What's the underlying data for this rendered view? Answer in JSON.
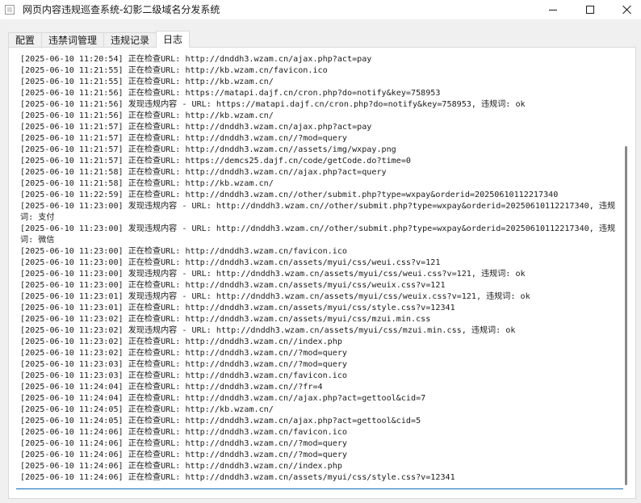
{
  "window": {
    "title": "网页内容违规巡查系统-幻影二级域名分发系统"
  },
  "tabs": [
    {
      "label": "配置"
    },
    {
      "label": "违禁词管理"
    },
    {
      "label": "违规记录"
    },
    {
      "label": "日志"
    }
  ],
  "active_tab": "日志",
  "log": {
    "lines": [
      "[2025-06-10 11:20:54] 正在检查URL: http://dnddh3.wzam.cn/ajax.php?act=pay",
      "[2025-06-10 11:21:55] 正在检查URL: http://kb.wzam.cn/favicon.ico",
      "[2025-06-10 11:21:55] 正在检查URL: http://kb.wzam.cn/",
      "[2025-06-10 11:21:56] 正在检查URL: https://matapi.dajf.cn/cron.php?do=notify&key=758953",
      "[2025-06-10 11:21:56] 发现违规内容 - URL: https://matapi.dajf.cn/cron.php?do=notify&key=758953, 违规词: ok",
      "[2025-06-10 11:21:56] 正在检查URL: http://kb.wzam.cn/",
      "[2025-06-10 11:21:57] 正在检查URL: http://dnddh3.wzam.cn/ajax.php?act=pay",
      "[2025-06-10 11:21:57] 正在检查URL: http://dnddh3.wzam.cn//?mod=query",
      "[2025-06-10 11:21:57] 正在检查URL: http://dnddh3.wzam.cn//assets/img/wxpay.png",
      "[2025-06-10 11:21:57] 正在检查URL: https://demcs25.dajf.cn/code/getCode.do?time=0",
      "[2025-06-10 11:21:58] 正在检查URL: http://dnddh3.wzam.cn//ajax.php?act=query",
      "[2025-06-10 11:21:58] 正在检查URL: http://kb.wzam.cn/",
      "[2025-06-10 11:22:59] 正在检查URL: http://dnddh3.wzam.cn//other/submit.php?type=wxpay&orderid=20250610112217340",
      "[2025-06-10 11:23:00] 发现违规内容 - URL: http://dnddh3.wzam.cn//other/submit.php?type=wxpay&orderid=20250610112217340, 违规词: 支付",
      "[2025-06-10 11:23:00] 发现违规内容 - URL: http://dnddh3.wzam.cn//other/submit.php?type=wxpay&orderid=20250610112217340, 违规词: 微信",
      "[2025-06-10 11:23:00] 正在检查URL: http://dnddh3.wzam.cn/favicon.ico",
      "[2025-06-10 11:23:00] 正在检查URL: http://dnddh3.wzam.cn/assets/myui/css/weui.css?v=121",
      "[2025-06-10 11:23:00] 发现违规内容 - URL: http://dnddh3.wzam.cn/assets/myui/css/weui.css?v=121, 违规词: ok",
      "[2025-06-10 11:23:00] 正在检查URL: http://dnddh3.wzam.cn/assets/myui/css/weuix.css?v=121",
      "[2025-06-10 11:23:01] 发现违规内容 - URL: http://dnddh3.wzam.cn/assets/myui/css/weuix.css?v=121, 违规词: ok",
      "[2025-06-10 11:23:01] 正在检查URL: http://dnddh3.wzam.cn/assets/myui/css/style.css?v=12341",
      "[2025-06-10 11:23:02] 正在检查URL: http://dnddh3.wzam.cn/assets/myui/css/mzui.min.css",
      "[2025-06-10 11:23:02] 发现违规内容 - URL: http://dnddh3.wzam.cn/assets/myui/css/mzui.min.css, 违规词: ok",
      "[2025-06-10 11:23:02] 正在检查URL: http://dnddh3.wzam.cn//index.php",
      "[2025-06-10 11:23:02] 正在检查URL: http://dnddh3.wzam.cn//?mod=query",
      "[2025-06-10 11:23:03] 正在检查URL: http://dnddh3.wzam.cn//?mod=query",
      "[2025-06-10 11:23:03] 正在检查URL: http://dnddh3.wzam.cn/favicon.ico",
      "[2025-06-10 11:24:04] 正在检查URL: http://dnddh3.wzam.cn//?fr=4",
      "[2025-06-10 11:24:04] 正在检查URL: http://dnddh3.wzam.cn//ajax.php?act=gettool&cid=7",
      "[2025-06-10 11:24:05] 正在检查URL: http://kb.wzam.cn/",
      "[2025-06-10 11:24:05] 正在检查URL: http://dnddh3.wzam.cn/ajax.php?act=gettool&cid=5",
      "[2025-06-10 11:24:06] 正在检查URL: http://dnddh3.wzam.cn/favicon.ico",
      "[2025-06-10 11:24:06] 正在检查URL: http://dnddh3.wzam.cn//?mod=query",
      "[2025-06-10 11:24:06] 正在检查URL: http://dnddh3.wzam.cn//?mod=query",
      "[2025-06-10 11:24:06] 正在检查URL: http://dnddh3.wzam.cn//index.php",
      "[2025-06-10 11:24:06] 正在检查URL: http://dnddh3.wzam.cn/assets/myui/css/style.css?v=12341"
    ]
  }
}
